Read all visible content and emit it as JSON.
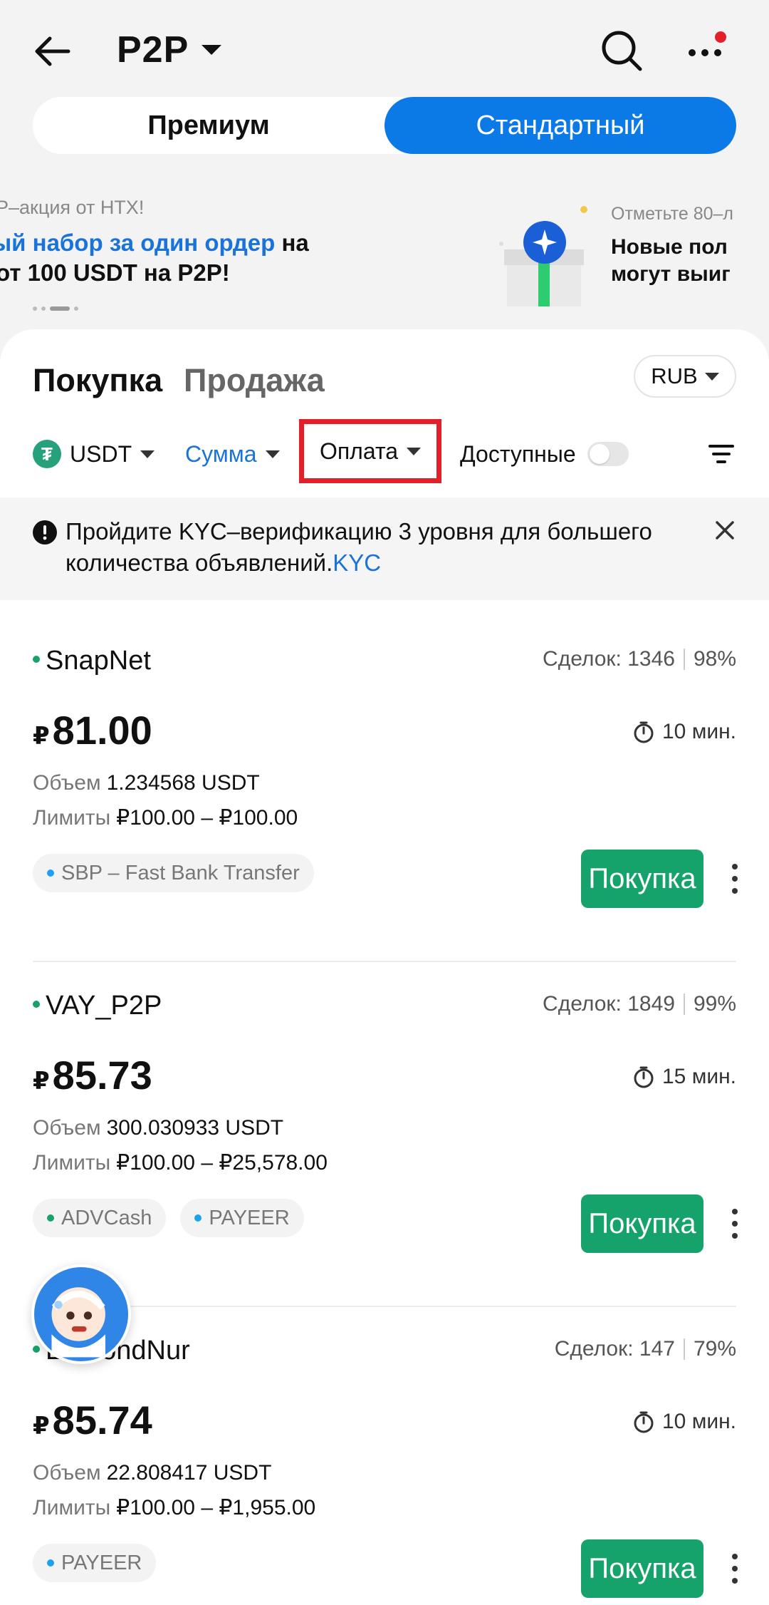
{
  "header": {
    "title": "P2P"
  },
  "segment": {
    "premium": "Премиум",
    "standard": "Стандартный"
  },
  "banner": {
    "promo1": {
      "subtitle": "Р–акция от HTX!",
      "line1_blue": "ый набор за один ордер",
      "line1_rest": " на",
      "line2": "от 100 USDT на P2P!"
    },
    "promo2": {
      "subtitle": "Отметьте 80–л",
      "line1": "Новые пол",
      "line2": "могут выиг"
    }
  },
  "tabs": {
    "buy": "Покупка",
    "sell": "Продажа"
  },
  "currency": "RUB",
  "filters": {
    "crypto": "USDT",
    "amount": "Сумма",
    "payment": "Оплата",
    "available": "Доступные"
  },
  "notice": {
    "text": "Пройдите KYC–верификацию 3 уровня для большего количества объявлений.",
    "link": "KYC"
  },
  "ads": [
    {
      "merchant": "SnapNet",
      "deals": "Сделок: 1346",
      "completion": "98%",
      "currency_symbol": "₽",
      "price": "81.00",
      "time": "10 мин.",
      "volume_label": "Объем",
      "volume": "1.234568 USDT",
      "limits_label": "Лимиты",
      "limits": "₽100.00 – ₽100.00",
      "methods": [
        {
          "name": "SBP – Fast Bank Transfer",
          "color": "#1da1f2"
        }
      ],
      "buy_label": "Покупка"
    },
    {
      "merchant": "VAY_P2P",
      "deals": "Сделок: 1849",
      "completion": "99%",
      "currency_symbol": "₽",
      "price": "85.73",
      "time": "15 мин.",
      "volume_label": "Объем",
      "volume": "300.030933 USDT",
      "limits_label": "Лимиты",
      "limits": "₽100.00 – ₽25,578.00",
      "methods": [
        {
          "name": "ADVCash",
          "color": "#16a36b"
        },
        {
          "name": "PAYEER",
          "color": "#1da1f2"
        }
      ],
      "buy_label": "Покупка"
    },
    {
      "merchant": "EdmondNur",
      "deals": "Сделок: 147",
      "completion": "79%",
      "currency_symbol": "₽",
      "price": "85.74",
      "time": "10 мин.",
      "volume_label": "Объем",
      "volume": "22.808417 USDT",
      "limits_label": "Лимиты",
      "limits": "₽100.00 – ₽1,955.00",
      "methods": [
        {
          "name": "PAYEER",
          "color": "#1da1f2"
        }
      ],
      "buy_label": "Покупка"
    }
  ],
  "colors": {
    "accent_blue": "#0b7ae6",
    "buy_green": "#16a36b",
    "highlight_red": "#e3202a"
  }
}
